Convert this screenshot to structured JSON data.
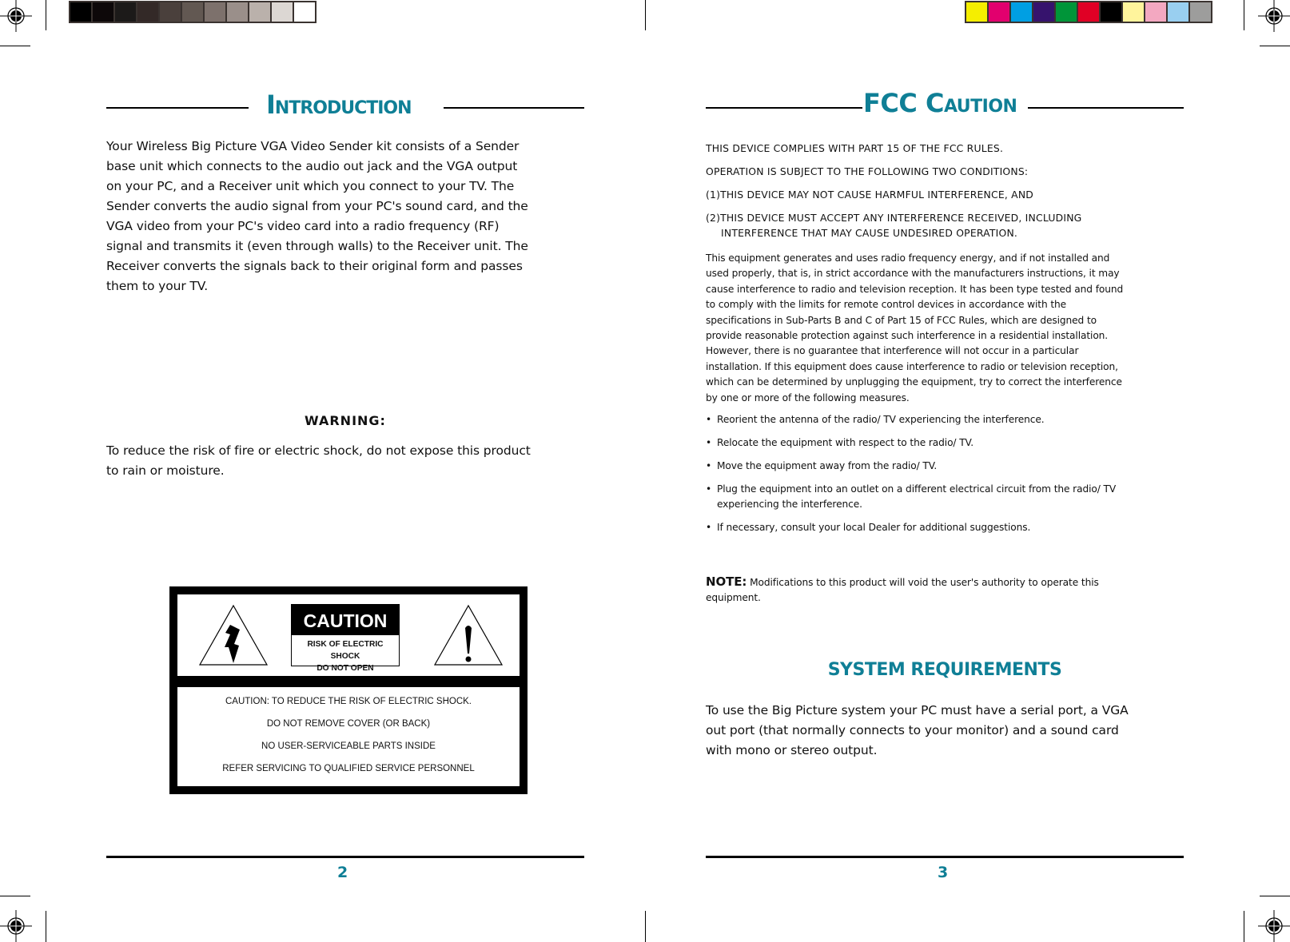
{
  "print_marks": {
    "grayscale_swatches": [
      "#000000",
      "#0d0809",
      "#1c1a19",
      "#332927",
      "#4a403c",
      "#625852",
      "#7d716c",
      "#9a8f8a",
      "#bab1ab",
      "#dcd7d3",
      "#ffffff"
    ],
    "color_swatches": [
      "#f5ee00",
      "#e2006e",
      "#009fe3",
      "#36136d",
      "#009539",
      "#e00025",
      "#000000",
      "#fff49c",
      "#f3a8c1",
      "#99cff0",
      "#9d9d9c"
    ]
  },
  "colors": {
    "accent": "#0f7f96"
  },
  "left_page": {
    "title_first": "I",
    "title_rest": "NTRODUCTION",
    "intro_lines": [
      "Your Wireless Big Picture VGA Video Sender kit consists of a Sender",
      "base unit which connects to the audio out jack and the VGA output",
      "on your PC, and a Receiver unit which you connect to your TV. The",
      "Sender converts the audio signal from your PC's sound card, and the",
      "VGA video from your PC's video card into a radio frequency (RF)",
      "signal and transmits it (even through walls) to the Receiver unit. The",
      "Receiver converts the signals back to their original form and passes",
      "them to your TV."
    ],
    "warning_heading": "WARNING:",
    "warning_lines": [
      "To reduce the risk of fire or electric shock, do not expose this product",
      "to rain or moisture."
    ],
    "caution_label": {
      "heading": "CAUTION",
      "sub_line1": "RISK OF ELECTRIC SHOCK",
      "sub_line2": "DO NOT OPEN",
      "left_icon": "lightning-bolt-warning-icon",
      "right_icon": "exclamation-warning-icon",
      "instructions": [
        "CAUTION: TO REDUCE THE RISK OF ELECTRIC SHOCK.",
        "DO NOT REMOVE COVER (OR BACK)",
        "NO USER-SERVICEABLE PARTS INSIDE",
        "REFER SERVICING TO QUALIFIED SERVICE PERSONNEL"
      ]
    },
    "page_number": "2"
  },
  "right_page": {
    "title_fcc": "FCC ",
    "title_first": "C",
    "title_rest": "AUTION",
    "caps_lines": [
      "THIS DEVICE COMPLIES WITH PART 15 OF THE FCC RULES.",
      "OPERATION IS SUBJECT TO THE FOLLOWING TWO CONDITIONS:",
      "(1)THIS DEVICE MAY NOT CAUSE HARMFUL INTERFERENCE, AND",
      "(2)THIS DEVICE MUST ACCEPT ANY INTERFERENCE RECEIVED, INCLUDING",
      "INTERFERENCE THAT MAY CAUSE UNDESIRED OPERATION."
    ],
    "paragraph_lines": [
      "This equipment generates and uses radio frequency energy, and if not installed and",
      "used properly, that is, in strict accordance with the manufacturers instructions, it may",
      "cause interference to radio and television reception. It has been type tested and found",
      "to comply with the limits for remote control devices in accordance with the",
      "specifications in Sub-Parts B and C of Part 15 of FCC Rules, which are designed to",
      "provide reasonable protection against such interference in a residential installation.",
      "However, there is no guarantee that interference will not occur in a particular",
      "installation. If this equipment does cause interference to radio or television reception,",
      "which can be determined by unplugging the equipment, try to correct the interference",
      "by one or more of the following measures."
    ],
    "bullets": [
      {
        "line1": "Reorient the antenna of the radio/ TV experiencing the interference."
      },
      {
        "line1": "Relocate the equipment with respect to the radio/ TV."
      },
      {
        "line1": "Move the equipment away from the radio/ TV."
      },
      {
        "line1": "Plug the equipment into an outlet on a different electrical circuit from the radio/ TV",
        "line2": "experiencing the interference."
      },
      {
        "line1": "If necessary, consult your local Dealer for additional suggestions."
      }
    ],
    "note_label": "NOTE:",
    "note_text": " Modifications to this product will void the user's authority to operate this",
    "note_text_line2": "equipment.",
    "sysreq_heading": "SYSTEM REQUIREMENTS",
    "sysreq_lines": [
      "To use the Big Picture system your PC must have a serial port, a VGA",
      "out port (that normally connects to your monitor) and a sound card",
      "with mono or stereo output."
    ],
    "page_number": "3"
  }
}
